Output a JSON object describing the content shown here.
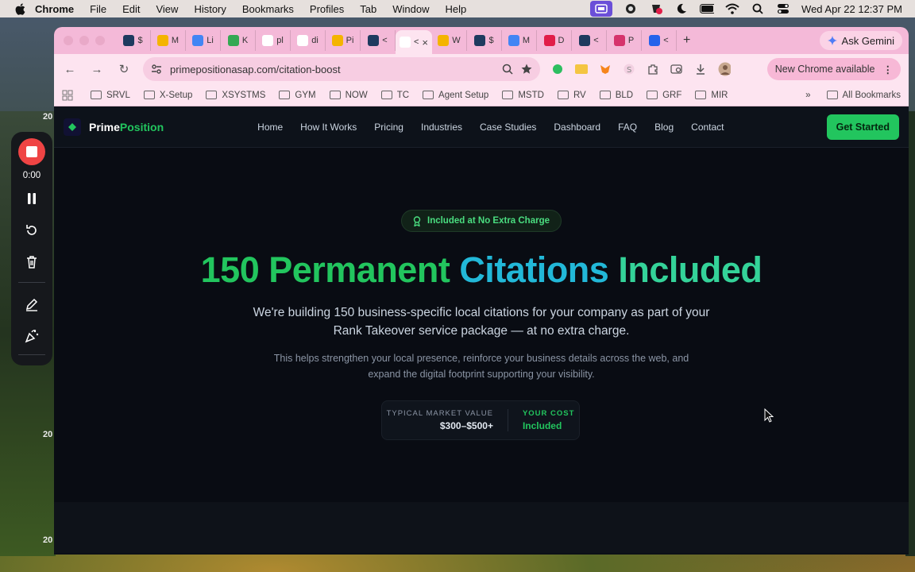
{
  "menubar": {
    "app": "Chrome",
    "items": [
      "File",
      "Edit",
      "View",
      "History",
      "Bookmarks",
      "Profiles",
      "Tab",
      "Window",
      "Help"
    ],
    "clock": "Wed Apr 22  12:37 PM"
  },
  "tabs": [
    {
      "icon": "dollar-icon",
      "label": "$",
      "color": "#1e3a5f"
    },
    {
      "icon": "slides-icon",
      "label": "M",
      "color": "#f4b400"
    },
    {
      "icon": "docs-icon",
      "label": "Li",
      "color": "#4285f4"
    },
    {
      "icon": "ads-icon",
      "label": "K",
      "color": "#34a853"
    },
    {
      "icon": "google-icon",
      "label": "pl",
      "color": "#ffffff"
    },
    {
      "icon": "google-icon",
      "label": "di",
      "color": "#ffffff"
    },
    {
      "icon": "slides-icon",
      "label": "Pi",
      "color": "#f4b400"
    },
    {
      "icon": "dollar-icon",
      "label": "<",
      "color": "#1e3a5f"
    },
    {
      "icon": "code-icon",
      "label": "<",
      "color": "#ffffff",
      "active": true
    },
    {
      "icon": "slides-icon",
      "label": "W",
      "color": "#f4b400"
    },
    {
      "icon": "dollar-icon",
      "label": "$",
      "color": "#1e3a5f"
    },
    {
      "icon": "docs-icon",
      "label": "M",
      "color": "#4285f4"
    },
    {
      "icon": "arrow-icon",
      "label": "D",
      "color": "#e11d48"
    },
    {
      "icon": "dollar-icon",
      "label": "<",
      "color": "#1e3a5f"
    },
    {
      "icon": "canva-icon",
      "label": "P",
      "color": "#d6336c"
    },
    {
      "icon": "gear-icon",
      "label": "<",
      "color": "#2563eb"
    }
  ],
  "gemini_label": "Ask Gemini",
  "address": {
    "url": "primepositionasap.com/citation-boost",
    "update_label": "New Chrome available"
  },
  "bookmarks": [
    "SRVL",
    "X-Setup",
    "XSYSTMS",
    "GYM",
    "NOW",
    "TC",
    "Agent Setup",
    "MSTD",
    "RV",
    "BLD",
    "GRF",
    "MIR"
  ],
  "all_bookmarks": "All Bookmarks",
  "site": {
    "brand_prime": "Prime",
    "brand_position": "Position",
    "nav": [
      "Home",
      "How It Works",
      "Pricing",
      "Industries",
      "Case Studies",
      "Dashboard",
      "FAQ",
      "Blog",
      "Contact"
    ],
    "cta": "Get Started"
  },
  "hero": {
    "badge": "Included at No Extra Charge",
    "headline_a": "150 Permanent ",
    "headline_b": "Citations ",
    "headline_c": "Included",
    "lead": "We're building 150 business-specific local citations for your company as part of your Rank Takeover service package — at no extra charge.",
    "sub": "This helps strengthen your local presence, reinforce your business details across the web, and expand the digital footprint supporting your visibility.",
    "market_label": "TYPICAL MARKET VALUE",
    "market_value": "$300–$500+",
    "cost_label": "YOUR COST",
    "cost_value": "Included"
  },
  "recorder": {
    "time": "0:00"
  },
  "desktop_labels": [
    "20",
    "20",
    "20"
  ]
}
